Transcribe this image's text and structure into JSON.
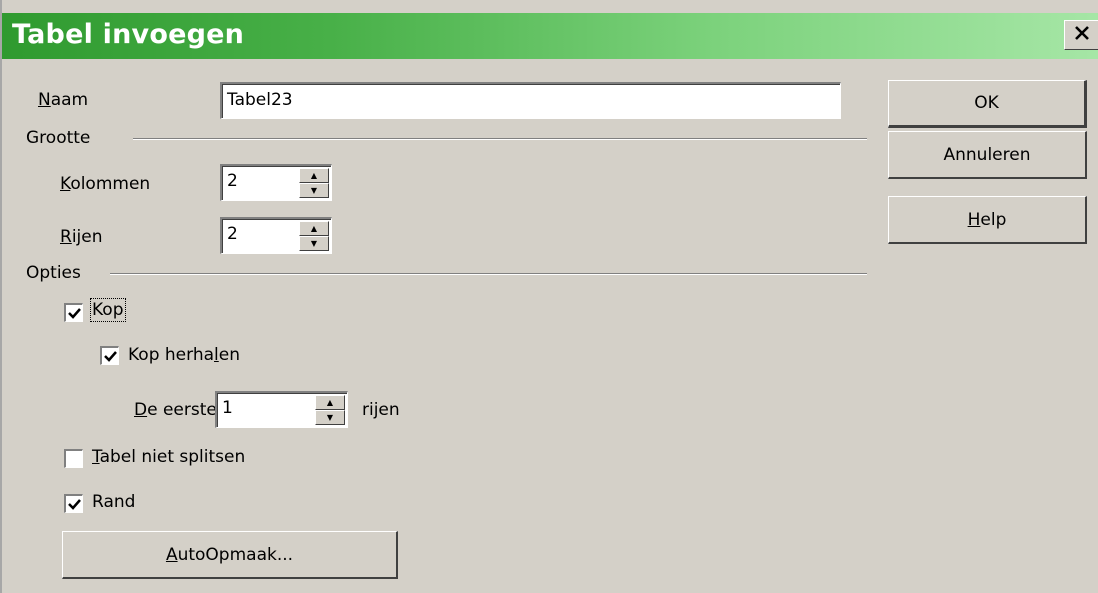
{
  "window": {
    "title": "Tabel invoegen",
    "close_icon": "close-icon"
  },
  "name_row": {
    "label_u": "N",
    "label_rest": "aam",
    "value": "Tabel23"
  },
  "size_group": {
    "title": "Grootte",
    "columns": {
      "label_u": "K",
      "label_rest": "olommen",
      "value": "2"
    },
    "rows": {
      "label_u": "R",
      "label_rest": "ijen",
      "value": "2"
    }
  },
  "options_group": {
    "title": "Opties",
    "heading": {
      "label": "Kop",
      "checked": true
    },
    "repeat_heading": {
      "label_pre": "Kop herha",
      "label_u": "l",
      "label_post": "en",
      "checked": true
    },
    "first_rows": {
      "label_u": "D",
      "label_rest": "e eerste",
      "value": "1",
      "suffix": "rijen"
    },
    "dont_split": {
      "label_u": "T",
      "label_rest": "abel niet splitsen",
      "checked": false
    },
    "border": {
      "label": "Rand",
      "checked": true
    },
    "autoformat": {
      "label_u": "A",
      "label_rest": "utoOpmaak..."
    }
  },
  "buttons": {
    "ok": "OK",
    "cancel": "Annuleren",
    "help_u": "H",
    "help_rest": "elp"
  }
}
